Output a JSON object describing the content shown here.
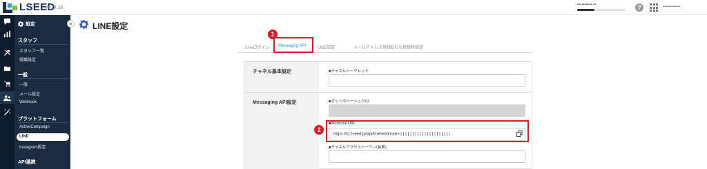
{
  "app": {
    "logo_text": "LSEED",
    "logo_sub": "SEED",
    "version": "Ver. 4.38",
    "brand_color": "#1a2f5c",
    "accent_color": "#1a9ed8",
    "annotation_color": "#e0192a"
  },
  "topbar": {
    "user_name": "▪▪▪▪▪▪▪▪▪▪ ▪▪",
    "account_name": "▪▪▪▪▪▪▪▪▪▪▪▪",
    "help_icon": "question-circle-icon",
    "apps_icon": "grid-icon",
    "usage_fraction": 0.35
  },
  "iconstrip": {
    "icons": [
      "chat-icon",
      "bar-chart-icon",
      "tools-icon",
      "folder-icon",
      "cart-icon",
      "users-icon",
      "magic-wand-icon"
    ]
  },
  "sidebar": {
    "collapse_label": "«",
    "settings_label": "設定",
    "sections": [
      {
        "title": "スタッフ",
        "items": [
          "スタッフ一覧",
          "役職設定"
        ]
      },
      {
        "title": "一般",
        "items": [
          "一般",
          "メール設定",
          "Webhook"
        ]
      },
      {
        "title": "プラットフォーム",
        "items": [
          "ActiveCampaign",
          "LINE",
          "Instagram設定"
        ]
      },
      {
        "title": "API連携",
        "items": []
      }
    ]
  },
  "page": {
    "title": "LINE設定"
  },
  "tabs": [
    {
      "label": "Lineログイン"
    },
    {
      "label": "Messaging API"
    },
    {
      "label": "LINE認証"
    },
    {
      "label": "メールアドレス登録"
    },
    {
      "label": "友だち登録時設定"
    }
  ],
  "form": {
    "rows": [
      {
        "label": "チャネル基本設定",
        "fields": [
          {
            "label": "■チャネルシークレット",
            "value": ""
          }
        ]
      },
      {
        "label": "Messaging API設定",
        "fields": [
          {
            "label": "■ボットのベーシックID",
            "value": ""
          },
          {
            "label": "■Webhook URL",
            "value": "https://s1.lseed.jp/api/line/webhook+"
          },
          {
            "label": "■チャネルアクセストークン(長期)",
            "value": ""
          }
        ]
      }
    ]
  },
  "annotations": [
    {
      "number": "1"
    },
    {
      "number": "2"
    }
  ]
}
